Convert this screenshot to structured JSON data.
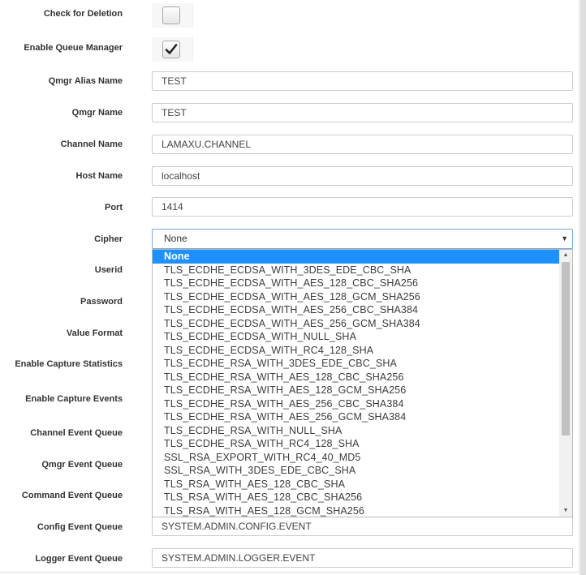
{
  "fields": {
    "check_for_deletion": {
      "label": "Check for Deletion",
      "checked": false
    },
    "enable_queue_manager": {
      "label": "Enable Queue Manager",
      "checked": true
    },
    "qmgr_alias_name": {
      "label": "Qmgr Alias Name",
      "value": "TEST"
    },
    "qmgr_name": {
      "label": "Qmgr Name",
      "value": "TEST"
    },
    "channel_name": {
      "label": "Channel Name",
      "value": "LAMAXU.CHANNEL"
    },
    "host_name": {
      "label": "Host Name",
      "value": "localhost"
    },
    "port": {
      "label": "Port",
      "value": "1414"
    },
    "cipher": {
      "label": "Cipher",
      "value": "None"
    },
    "userid": {
      "label": "Userid"
    },
    "password": {
      "label": "Password"
    },
    "value_format": {
      "label": "Value Format"
    },
    "enable_capture_statistics": {
      "label": "Enable Capture Statistics"
    },
    "enable_capture_events": {
      "label": "Enable Capture Events"
    },
    "channel_event_queue": {
      "label": "Channel Event Queue"
    },
    "qmgr_event_queue": {
      "label": "Qmgr Event Queue"
    },
    "command_event_queue": {
      "label": "Command Event Queue"
    },
    "config_event_queue": {
      "label": "Config Event Queue",
      "value": "SYSTEM.ADMIN.CONFIG.EVENT"
    },
    "logger_event_queue": {
      "label": "Logger Event Queue",
      "value": "SYSTEM.ADMIN.LOGGER.EVENT"
    }
  },
  "cipher_options": [
    "None",
    "TLS_ECDHE_ECDSA_WITH_3DES_EDE_CBC_SHA",
    "TLS_ECDHE_ECDSA_WITH_AES_128_CBC_SHA256",
    "TLS_ECDHE_ECDSA_WITH_AES_128_GCM_SHA256",
    "TLS_ECDHE_ECDSA_WITH_AES_256_CBC_SHA384",
    "TLS_ECDHE_ECDSA_WITH_AES_256_GCM_SHA384",
    "TLS_ECDHE_ECDSA_WITH_NULL_SHA",
    "TLS_ECDHE_ECDSA_WITH_RC4_128_SHA",
    "TLS_ECDHE_RSA_WITH_3DES_EDE_CBC_SHA",
    "TLS_ECDHE_RSA_WITH_AES_128_CBC_SHA256",
    "TLS_ECDHE_RSA_WITH_AES_128_GCM_SHA256",
    "TLS_ECDHE_RSA_WITH_AES_256_CBC_SHA384",
    "TLS_ECDHE_RSA_WITH_AES_256_GCM_SHA384",
    "TLS_ECDHE_RSA_WITH_NULL_SHA",
    "TLS_ECDHE_RSA_WITH_RC4_128_SHA",
    "SSL_RSA_EXPORT_WITH_RC4_40_MD5",
    "SSL_RSA_WITH_3DES_EDE_CBC_SHA",
    "TLS_RSA_WITH_AES_128_CBC_SHA",
    "TLS_RSA_WITH_AES_128_CBC_SHA256",
    "TLS_RSA_WITH_AES_128_GCM_SHA256"
  ],
  "cipher_selected_index": 0,
  "icons": {
    "check": "checkmark-icon",
    "dropdown_arrow": "▼",
    "scroll_up": "▲",
    "scroll_down": "▼"
  },
  "colors": {
    "selected_option_bg": "#1e90ff",
    "select_focus_border": "#7aa7d6"
  }
}
